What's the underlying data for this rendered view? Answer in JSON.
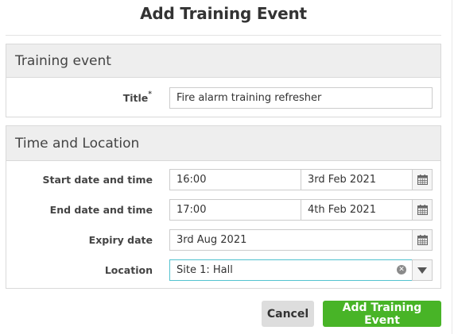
{
  "dialog": {
    "title": "Add Training Event"
  },
  "training_event": {
    "heading": "Training event",
    "title_label": "Title",
    "required_marker": "*",
    "title_value": "Fire alarm training refresher"
  },
  "time_location": {
    "heading": "Time and Location",
    "start": {
      "label": "Start date and time",
      "time": "16:00",
      "date": "3rd Feb 2021"
    },
    "end": {
      "label": "End date and time",
      "time": "17:00",
      "date": "4th Feb 2021"
    },
    "expiry": {
      "label": "Expiry date",
      "date": "3rd Aug 2021"
    },
    "location": {
      "label": "Location",
      "value": "Site 1: Hall"
    }
  },
  "actions": {
    "cancel_label": "Cancel",
    "submit_label": "Add Training Event"
  },
  "colors": {
    "primary_green": "#48b427",
    "focus_border": "#52c2cf",
    "section_header_bg": "#eeeeee"
  },
  "icons": {
    "calendar": "calendar-icon",
    "clear": "clear-icon",
    "dropdown": "chevron-down-icon"
  }
}
